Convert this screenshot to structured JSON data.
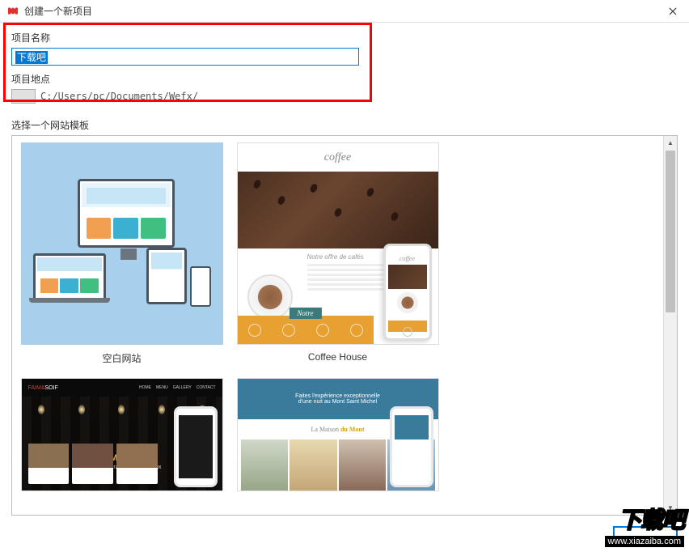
{
  "window": {
    "title": "创建一个新项目"
  },
  "form": {
    "name_label": "项目名称",
    "name_value": "下载吧",
    "location_label": "项目地点",
    "location_path": "C:/Users/pc/Documents/Wefx/"
  },
  "templates": {
    "section_label": "选择一个网站模板",
    "items": [
      {
        "name": "空白网站"
      },
      {
        "name": "Coffee House"
      },
      {
        "name": ""
      },
      {
        "name": ""
      },
      {
        "name": ""
      },
      {
        "name": ""
      }
    ],
    "coffee": {
      "logo": "coffee",
      "menu_title": "Notre offre de cafés",
      "footer_label": "Notre"
    },
    "faim": {
      "logo_a": "FAIM&",
      "logo_b": "SOIF",
      "title": "FAIM&SOIF",
      "subtitle": "Bar & restaurant pour bordeaux"
    },
    "maison": {
      "banner1": "Faites l'expérience exceptionnelle",
      "banner2": "d'une nuit au Mont Saint Michel",
      "sub_a": "La Maison",
      "sub_b": "du Mont"
    }
  },
  "watermark": {
    "main": "下载吧",
    "url": "www.xiazaiba.com"
  }
}
